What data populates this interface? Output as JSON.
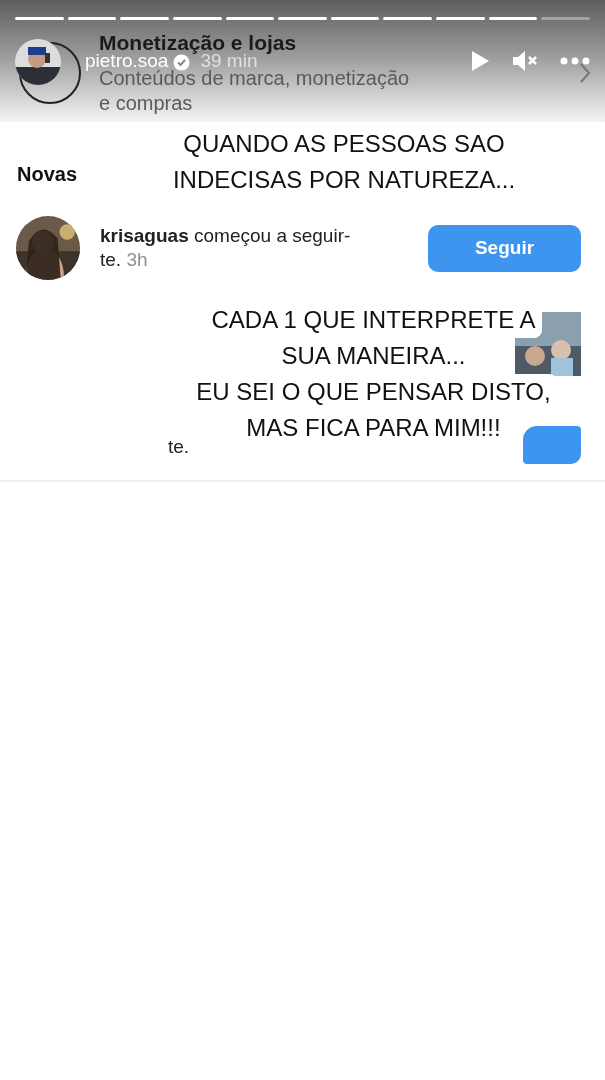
{
  "story": {
    "progress": [
      {
        "level": 1
      },
      {
        "level": 1
      },
      {
        "level": 1
      },
      {
        "level": 1
      },
      {
        "level": 1
      },
      {
        "level": 1
      },
      {
        "level": 1
      },
      {
        "level": 1
      },
      {
        "level": 1
      },
      {
        "level": 1
      },
      {
        "level": 0
      }
    ],
    "author": {
      "username": "pietro.soa",
      "verified": true,
      "time": "39 min"
    },
    "muted": true
  },
  "screenshot": {
    "section": {
      "title": "Monetização e lojas",
      "subtitle_lines": [
        "Conteúdos de marca, monetização",
        "e compras"
      ]
    },
    "heading": "Novas",
    "notification": {
      "username": "krisaguas",
      "action": "começou a seguir-te.",
      "time": "3h",
      "button": "Seguir"
    },
    "fragment": "te."
  },
  "captions": [
    {
      "lines": [
        "QUANDO AS PESSOAS SAO",
        "INDECISAS POR NATUREZA..."
      ]
    },
    {
      "lines": [
        "CADA 1 QUE INTERPRETE A",
        "SUA MANEIRA...",
        "EU SEI O QUE PENSAR DISTO,",
        "MAS FICA PARA MIM!!!"
      ]
    }
  ]
}
